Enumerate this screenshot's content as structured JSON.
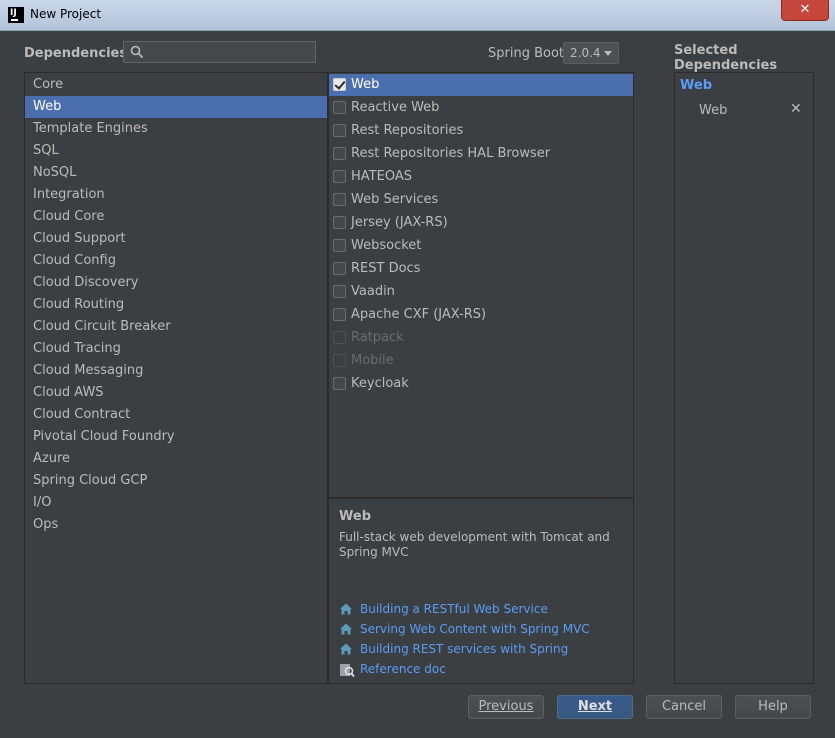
{
  "window": {
    "title": "New Project",
    "app_icon_text": "IJ"
  },
  "header": {
    "dependencies_label": "Dependencies",
    "search_placeholder": "",
    "spring_boot_label": "Spring Boot",
    "spring_boot_version": "2.0.4",
    "selected_label": "Selected Dependencies"
  },
  "categories": [
    "Core",
    "Web",
    "Template Engines",
    "SQL",
    "NoSQL",
    "Integration",
    "Cloud Core",
    "Cloud Support",
    "Cloud Config",
    "Cloud Discovery",
    "Cloud Routing",
    "Cloud Circuit Breaker",
    "Cloud Tracing",
    "Cloud Messaging",
    "Cloud AWS",
    "Cloud Contract",
    "Pivotal Cloud Foundry",
    "Azure",
    "Spring Cloud GCP",
    "I/O",
    "Ops"
  ],
  "selected_category": "Web",
  "items": [
    {
      "label": "Web",
      "checked": true,
      "enabled": true
    },
    {
      "label": "Reactive Web",
      "checked": false,
      "enabled": true
    },
    {
      "label": "Rest Repositories",
      "checked": false,
      "enabled": true
    },
    {
      "label": "Rest Repositories HAL Browser",
      "checked": false,
      "enabled": true
    },
    {
      "label": "HATEOAS",
      "checked": false,
      "enabled": true
    },
    {
      "label": "Web Services",
      "checked": false,
      "enabled": true
    },
    {
      "label": "Jersey (JAX-RS)",
      "checked": false,
      "enabled": true
    },
    {
      "label": "Websocket",
      "checked": false,
      "enabled": true
    },
    {
      "label": "REST Docs",
      "checked": false,
      "enabled": true
    },
    {
      "label": "Vaadin",
      "checked": false,
      "enabled": true
    },
    {
      "label": "Apache CXF (JAX-RS)",
      "checked": false,
      "enabled": true
    },
    {
      "label": "Ratpack",
      "checked": false,
      "enabled": false
    },
    {
      "label": "Mobile",
      "checked": false,
      "enabled": false
    },
    {
      "label": "Keycloak",
      "checked": false,
      "enabled": true
    }
  ],
  "description": {
    "title": "Web",
    "text": "Full-stack web development with Tomcat and Spring MVC",
    "links": [
      {
        "label": "Building a RESTful Web Service",
        "icon": "home-icon"
      },
      {
        "label": "Serving Web Content with Spring MVC",
        "icon": "home-icon"
      },
      {
        "label": "Building REST services with Spring",
        "icon": "home-icon"
      },
      {
        "label": "Reference doc",
        "icon": "doc-search-icon"
      }
    ]
  },
  "selected_dependencies": {
    "group": "Web",
    "items": [
      "Web"
    ],
    "remove_glyph": "✕"
  },
  "footer": {
    "previous": "Previous",
    "next": "Next",
    "cancel": "Cancel",
    "help": "Help"
  },
  "colors": {
    "selection": "#4b6eaf",
    "link": "#589df6",
    "background": "#3c3f41"
  }
}
